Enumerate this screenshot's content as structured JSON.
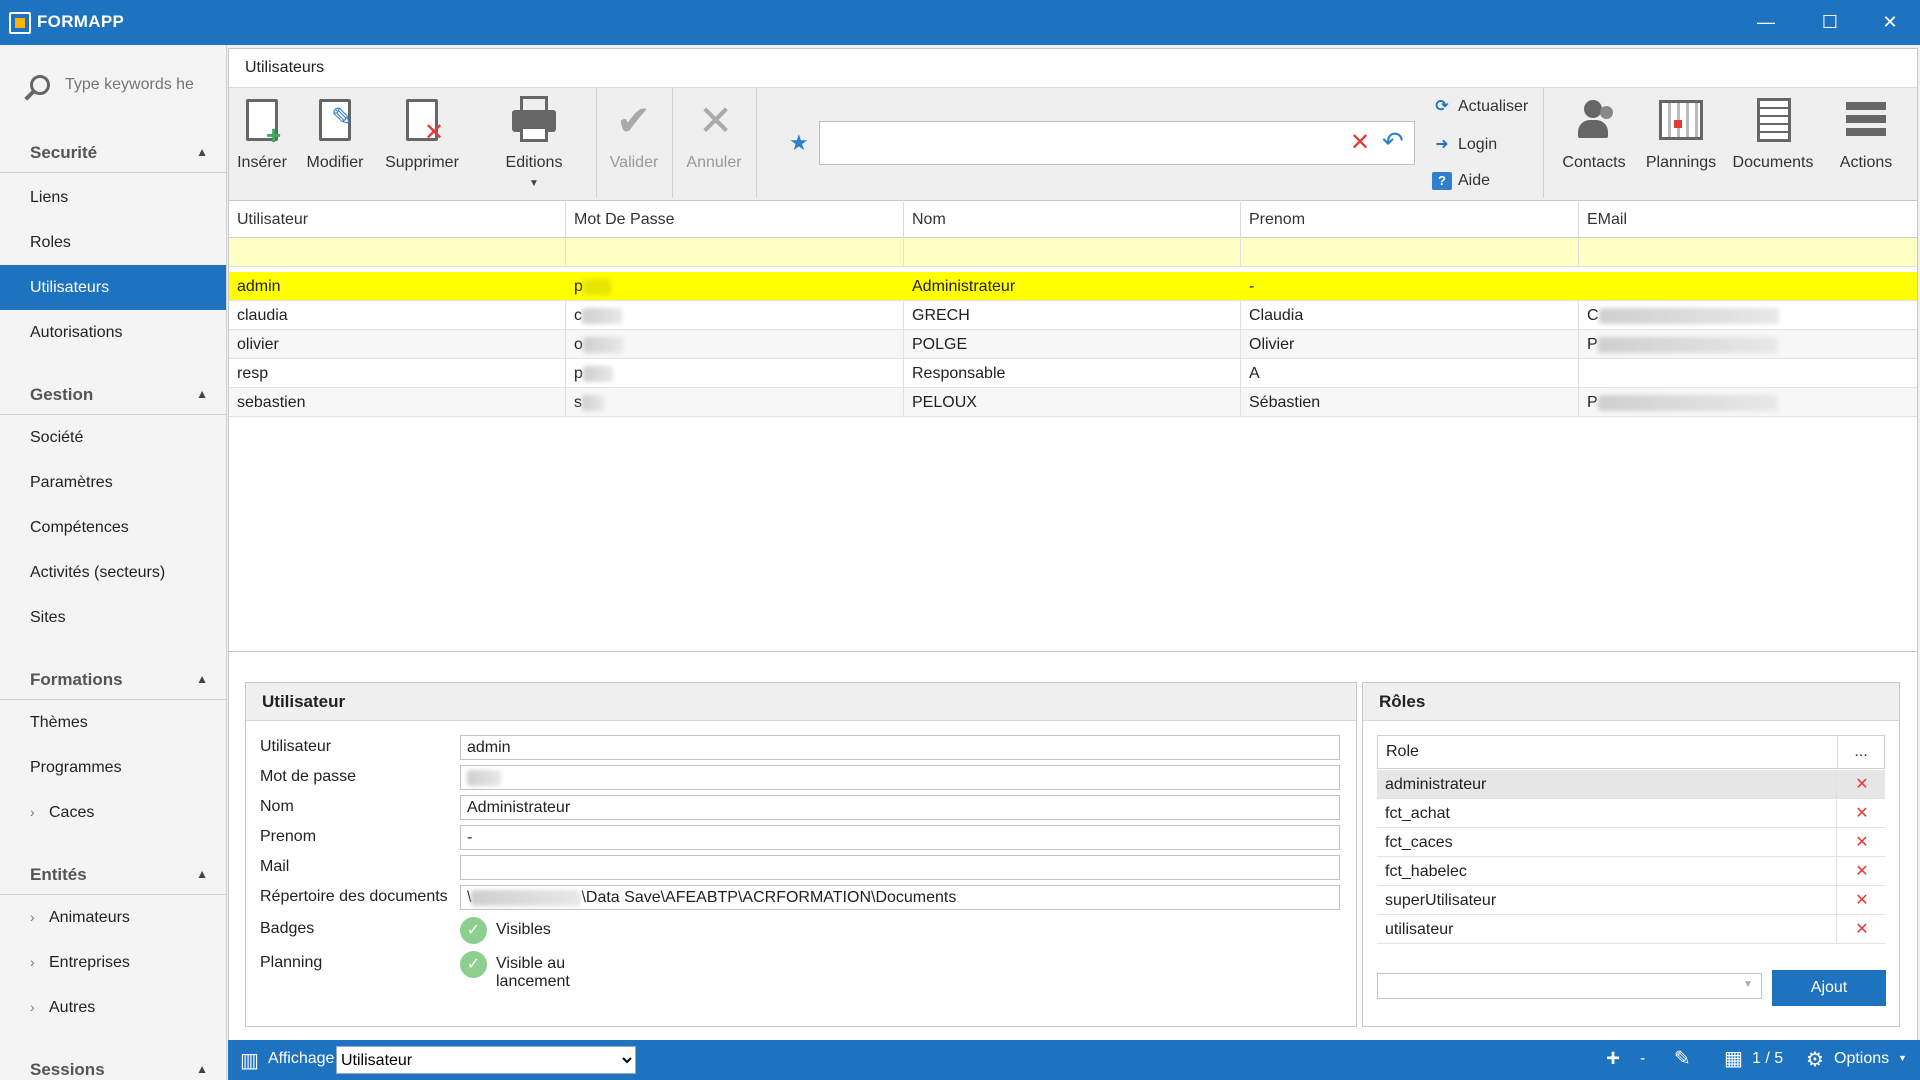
{
  "app": {
    "title": "FORMAPP",
    "window_controls": [
      "—",
      "☐",
      "✕"
    ]
  },
  "sidebar": {
    "search_placeholder": "Type keywords he",
    "sections": [
      {
        "label": "Securité",
        "items": [
          {
            "label": "Liens"
          },
          {
            "label": "Roles"
          },
          {
            "label": "Utilisateurs",
            "active": true
          },
          {
            "label": "Autorisations"
          }
        ]
      },
      {
        "label": "Gestion",
        "items": [
          {
            "label": "Société"
          },
          {
            "label": "Paramètres"
          },
          {
            "label": "Compétences"
          },
          {
            "label": "Activités (secteurs)"
          },
          {
            "label": "Sites"
          }
        ]
      },
      {
        "label": "Formations",
        "items": [
          {
            "label": "Thèmes"
          },
          {
            "label": "Programmes"
          },
          {
            "label": "Caces",
            "expandable": true
          }
        ]
      },
      {
        "label": "Entités",
        "items": [
          {
            "label": "Animateurs",
            "expandable": true
          },
          {
            "label": "Entreprises",
            "expandable": true
          },
          {
            "label": "Autres",
            "expandable": true
          }
        ]
      },
      {
        "label": "Sessions",
        "items": []
      }
    ]
  },
  "page": {
    "title": "Utilisateurs"
  },
  "toolbar": {
    "inserer": "Insérer",
    "modifier": "Modifier",
    "supprimer": "Supprimer",
    "editions": "Editions",
    "valider": "Valider",
    "annuler": "Annuler",
    "actualiser": "Actualiser",
    "login": "Login",
    "aide": "Aide",
    "contacts": "Contacts",
    "plannings": "Plannings",
    "documents": "Documents",
    "actions": "Actions",
    "search_value": ""
  },
  "grid": {
    "columns": [
      "Utilisateur",
      "Mot De Passe",
      "Nom",
      "Prenom",
      "EMail"
    ],
    "rows": [
      {
        "utilisateur": "admin",
        "mdp": "p",
        "nom": "Administrateur",
        "prenom": "-",
        "email": "",
        "selected": true
      },
      {
        "utilisateur": "claudia",
        "mdp": "c",
        "nom": "GRECH",
        "prenom": "Claudia",
        "email": "C"
      },
      {
        "utilisateur": "olivier",
        "mdp": "o",
        "nom": "POLGE",
        "prenom": "Olivier",
        "email": "P"
      },
      {
        "utilisateur": "resp",
        "mdp": "p",
        "nom": "Responsable",
        "prenom": "A",
        "email": ""
      },
      {
        "utilisateur": "sebastien",
        "mdp": "s",
        "nom": "PELOUX",
        "prenom": "Sébastien",
        "email": "P"
      }
    ]
  },
  "detail": {
    "title": "Utilisateur",
    "labels": {
      "utilisateur": "Utilisateur",
      "mdp": "Mot de passe",
      "nom": "Nom",
      "prenom": "Prenom",
      "mail": "Mail",
      "repertoire": "Répertoire des documents",
      "badges": "Badges",
      "planning": "Planning"
    },
    "values": {
      "utilisateur": "admin",
      "mdp": "",
      "nom": "Administrateur",
      "prenom": "-",
      "mail": "",
      "repertoire": "\\Data Save\\AFEABTP\\ACRFORMATION\\Documents",
      "repertoire_prefix": "\\",
      "badges": "Visibles",
      "planning": "Visible au lancement"
    }
  },
  "roles": {
    "title": "Rôles",
    "column": "Role",
    "more": "...",
    "items": [
      "administrateur",
      "fct_achat",
      "fct_caces",
      "fct_habelec",
      "superUtilisateur",
      "utilisateur"
    ],
    "add_button": "Ajout"
  },
  "statusbar": {
    "affichage_label": "Affichage",
    "affichage_value": "Utilisateur",
    "plus": "+",
    "minus": "-",
    "pager": "1 / 5",
    "options": "Options"
  },
  "colors": {
    "accent": "#1e73c1",
    "selected_row": "#ffff00",
    "filter_row": "#ffffc4",
    "delete": "#e53935"
  }
}
